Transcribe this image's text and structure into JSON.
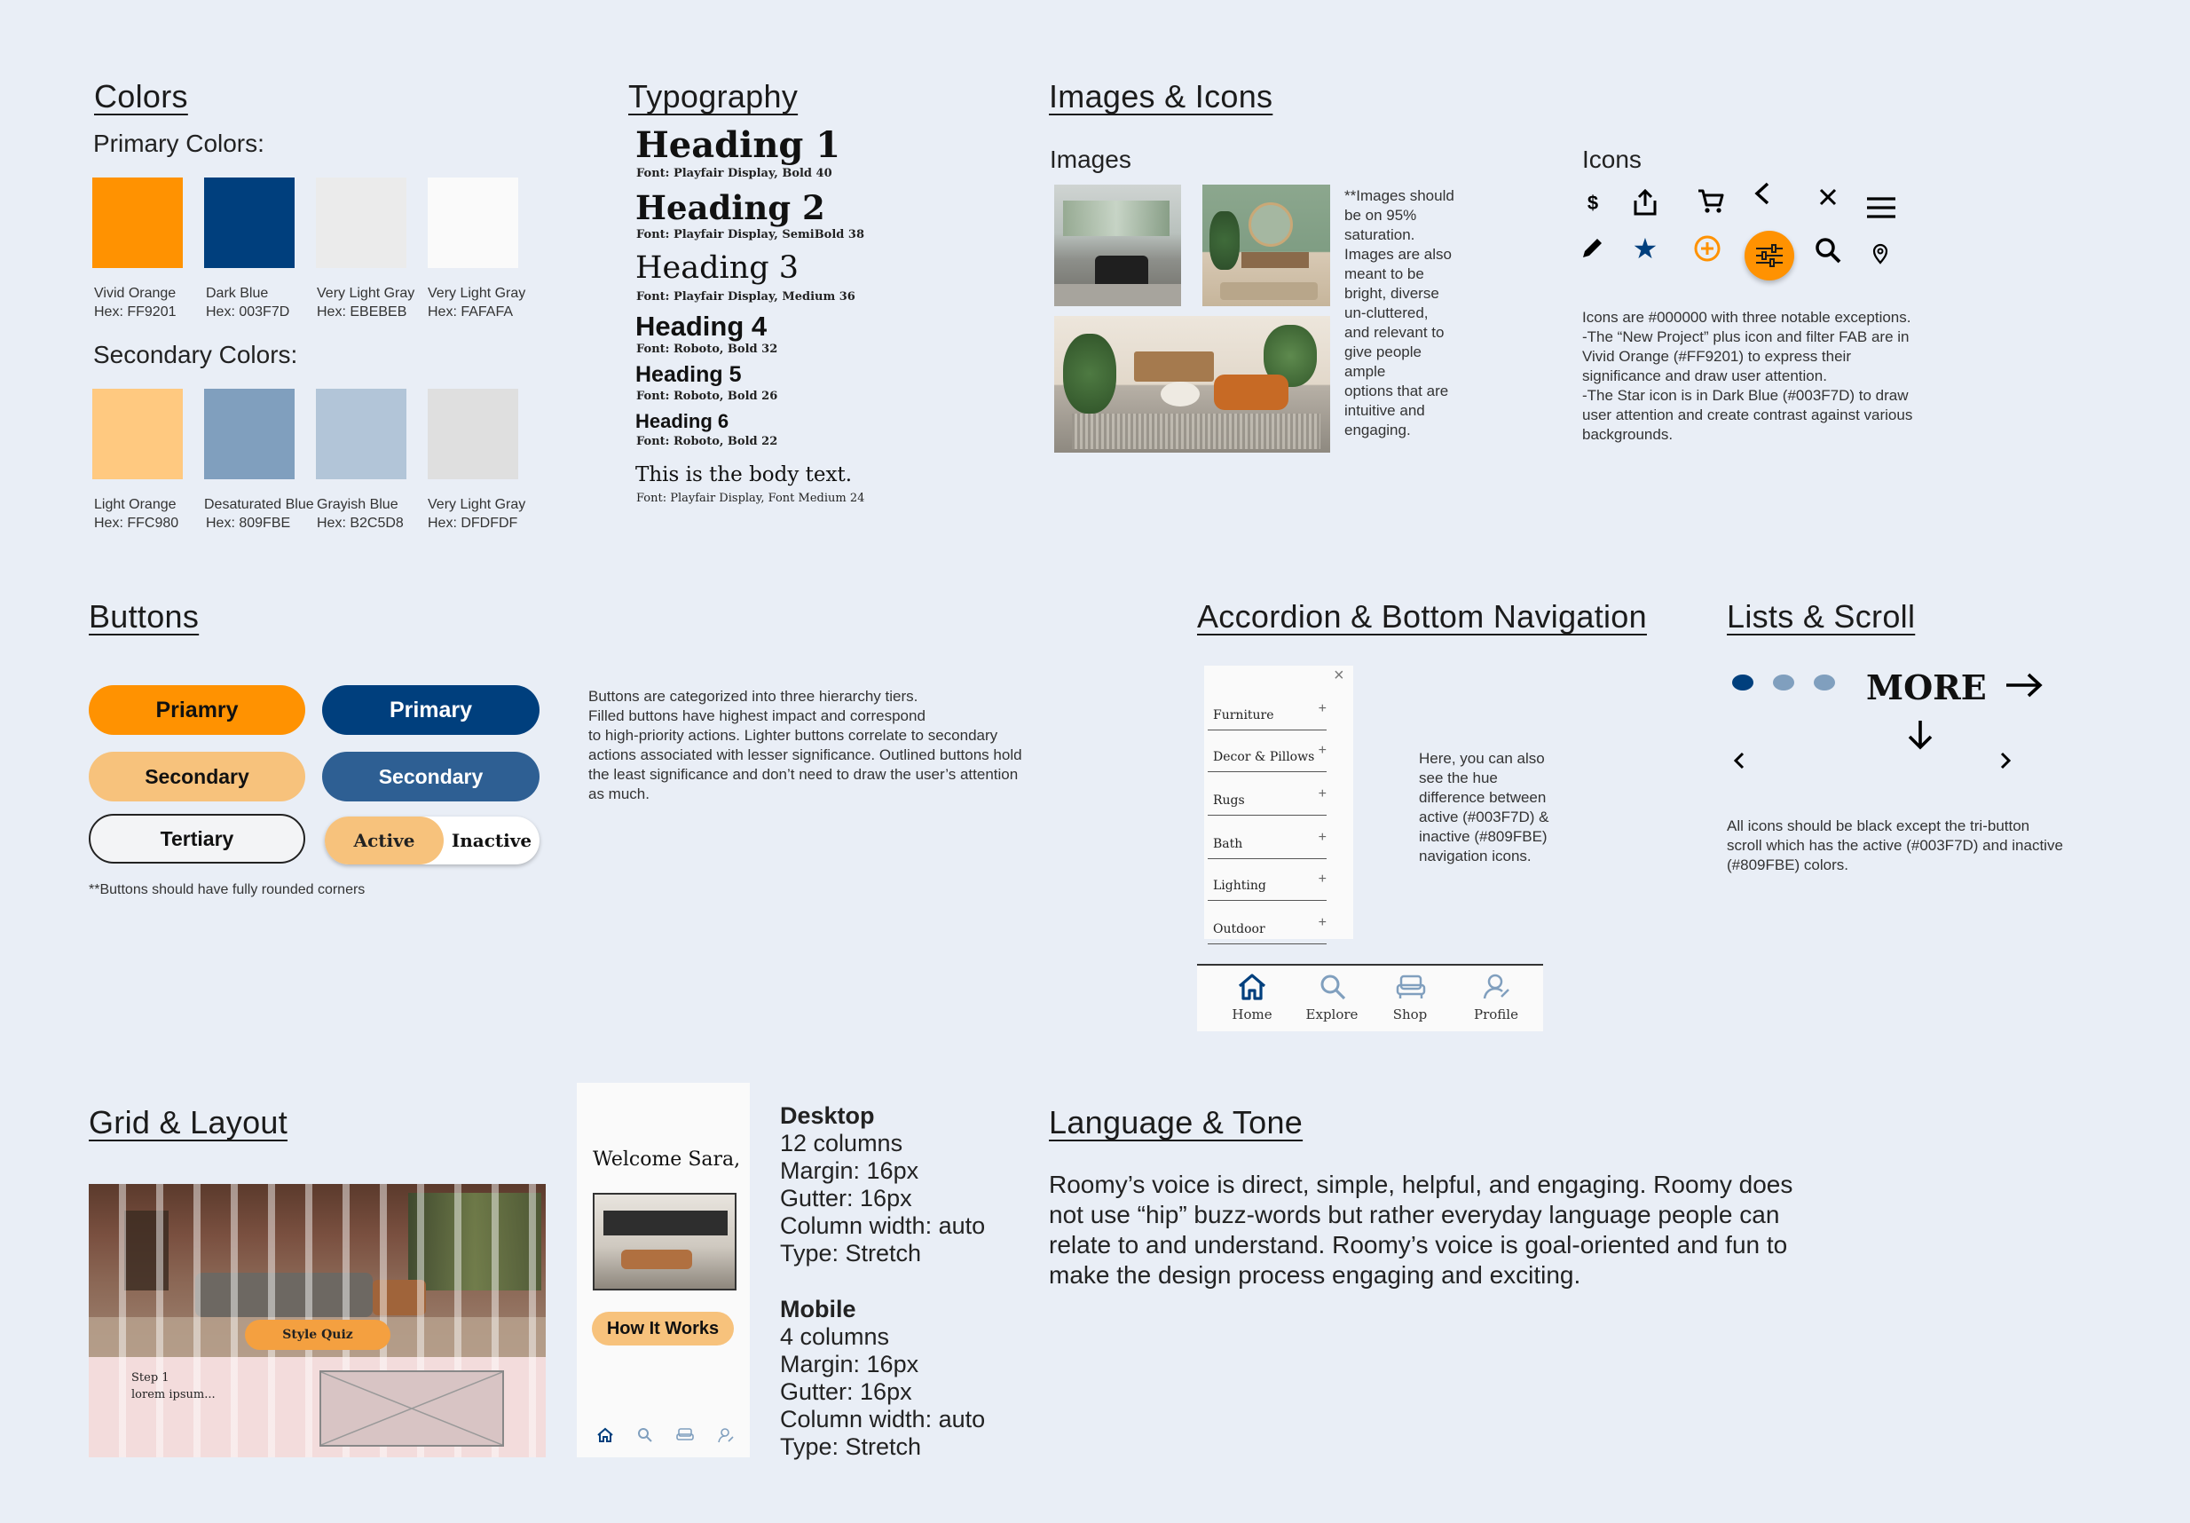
{
  "colors": {
    "title": "Colors",
    "primary_label": "Primary Colors:",
    "primary": [
      {
        "name": "Vivid Orange",
        "hex_label": "Hex: FF9201",
        "color": "#FF9201"
      },
      {
        "name": "Dark Blue",
        "hex_label": "Hex: 003F7D",
        "color": "#003F7D"
      },
      {
        "name": "Very Light Gray",
        "hex_label": "Hex: EBEBEB",
        "color": "#EBEBEB"
      },
      {
        "name": "Very Light Gray",
        "hex_label": "Hex: FAFAFA",
        "color": "#FAFAFA"
      }
    ],
    "secondary_label": "Secondary Colors:",
    "secondary": [
      {
        "name": "Light Orange",
        "hex_label": "Hex: FFC980",
        "color": "#FFC980"
      },
      {
        "name": "Desaturated Blue",
        "hex_label": "Hex: 809FBE",
        "color": "#809FBE"
      },
      {
        "name": "Grayish Blue",
        "hex_label": "Hex: B2C5D8",
        "color": "#B2C5D8"
      },
      {
        "name": "Very Light Gray",
        "hex_label": "Hex: DFDFDF",
        "color": "#DFDFDF"
      }
    ]
  },
  "typography": {
    "title": "Typography",
    "h1": "Heading 1",
    "h1_font": "Font: Playfair Display, Bold 40",
    "h2": "Heading 2",
    "h2_font": "Font: Playfair Display, SemiBold 38",
    "h3": "Heading 3",
    "h3_font": "Font: Playfair Display, Medium 36",
    "h4": "Heading 4",
    "h4_font": "Font: Roboto, Bold 32",
    "h5": "Heading 5",
    "h5_font": "Font: Roboto, Bold 26",
    "h6": "Heading 6",
    "h6_font": "Font: Roboto, Bold 22",
    "body": "This is the body text.",
    "body_font": "Font: Playfair Display, Font Medium 24"
  },
  "images_icons": {
    "title": "Images & Icons",
    "images_label": "Images",
    "images_note": [
      "**Images should",
      "be on 95%",
      "saturation.",
      "Images are also",
      "meant to be",
      "bright, diverse",
      "un-cluttered,",
      "and relevant to",
      "give people",
      "ample",
      "options that are",
      "intuitive and",
      "engaging."
    ],
    "icons_label": "Icons",
    "icons_note": [
      "Icons are #000000 with three notable exceptions.",
      "-The “New Project” plus icon and filter FAB are in",
      "Vivid Orange (#FF9201) to express their",
      "significance and draw user attention.",
      "-The Star icon is in Dark Blue (#003F7D) to draw",
      "user attention and create contrast against various",
      "backgrounds."
    ],
    "icon_dollar_glyph": "$"
  },
  "buttons": {
    "title": "Buttons",
    "primary_orange": "Priamry",
    "primary_blue": "Primary",
    "secondary_orange": "Secondary",
    "secondary_blue": "Secondary",
    "tertiary": "Tertiary",
    "active": "Active",
    "inactive": "Inactive",
    "footnote": "**Buttons should have fully rounded corners",
    "description": [
      "Buttons are categorized into three hierarchy tiers.",
      "Filled buttons have highest impact and correspond",
      "to high-priority actions. Lighter buttons correlate to secondary",
      "actions associated with lesser significance. Outlined buttons hold",
      "the least significance and don’t need to draw the user’s attention",
      "as much."
    ]
  },
  "accordion": {
    "title": "Accordion & Bottom Navigation",
    "items": [
      "Furniture",
      "Decor & Pillows",
      "Rugs",
      "Bath",
      "Lighting",
      "Outdoor"
    ],
    "close_glyph": "×",
    "plus_glyph": "+",
    "note": [
      "Here, you can also",
      "see the hue",
      "difference between",
      "active (#003F7D) &",
      "inactive (#809FBE)",
      "navigation icons."
    ],
    "nav": [
      {
        "label": "Home"
      },
      {
        "label": "Explore"
      },
      {
        "label": "Shop"
      },
      {
        "label": "Profile"
      }
    ]
  },
  "lists": {
    "title": "Lists & Scroll",
    "more": "MORE",
    "note": [
      "All icons should be black except the tri-button",
      "scroll which has the active (#003F7D) and inactive",
      "(#809FBE) colors."
    ],
    "active_color": "#003F7D",
    "inactive_color": "#809FBE"
  },
  "grid": {
    "title": "Grid & Layout",
    "style_quiz": "Style Quiz",
    "step": "Step 1",
    "lorem": "lorem ipsum...",
    "welcome": "Welcome Sara,",
    "how_it_works": "How It Works",
    "desktop": {
      "label": "Desktop",
      "lines": [
        "12 columns",
        "Margin: 16px",
        "Gutter: 16px",
        "Column width: auto",
        "Type: Stretch"
      ]
    },
    "mobile": {
      "label": "Mobile",
      "lines": [
        "4 columns",
        "Margin: 16px",
        "Gutter: 16px",
        "Column width: auto",
        "Type: Stretch"
      ]
    }
  },
  "language": {
    "title": "Language & Tone",
    "text": [
      "Roomy’s voice is direct, simple, helpful, and engaging. Roomy does",
      "not use “hip” buzz-words but rather everyday language people can",
      "relate to and understand. Roomy’s voice is goal-oriented and fun to",
      "make the design process engaging and exciting."
    ]
  }
}
